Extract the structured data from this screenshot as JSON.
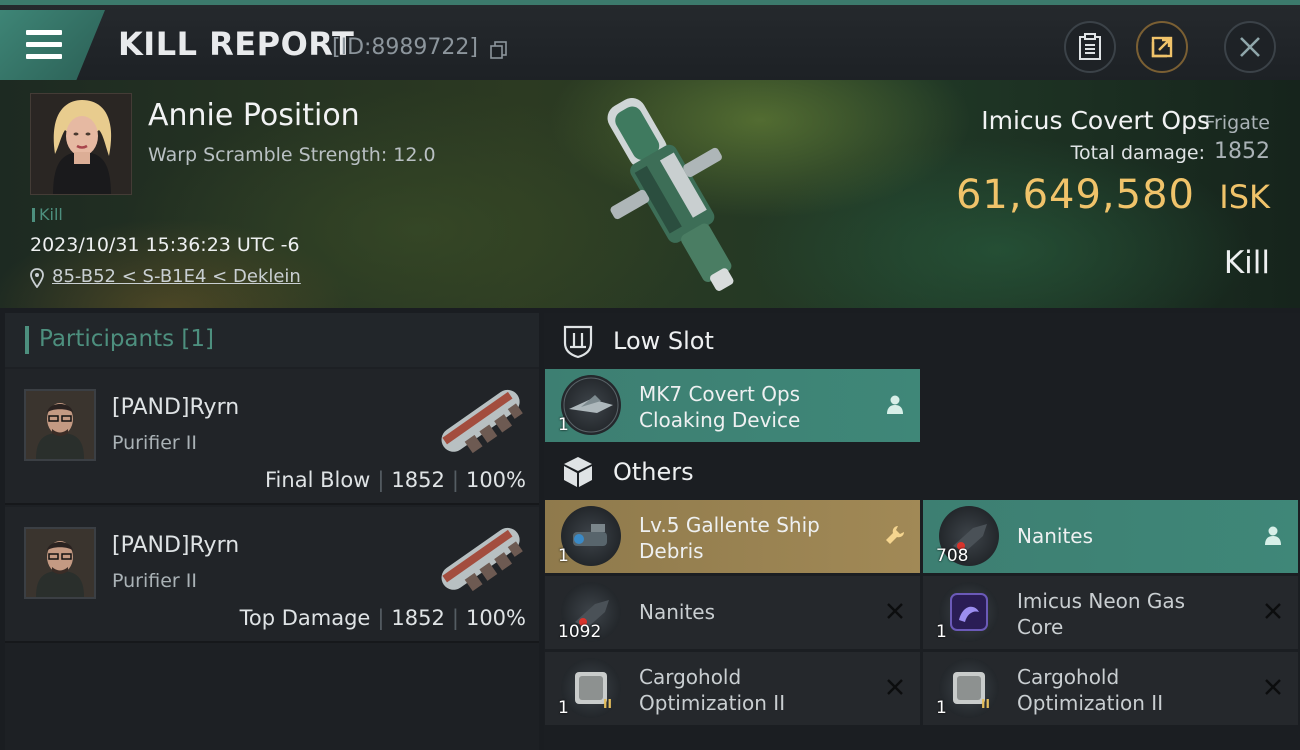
{
  "header": {
    "title": "KILL REPORT",
    "report_id": "[ID:8989722]"
  },
  "victim": {
    "name": "Annie Position",
    "warp_scramble": "Warp Scramble Strength: 12.0",
    "kill_tag": "Kill",
    "datetime": "2023/10/31 15:36:23 UTC -6",
    "location": "85-B52 < S-B1E4 < Deklein",
    "ship_name": "Imicus Covert Ops",
    "ship_class": "Frigate",
    "total_damage_label": "Total damage:",
    "total_damage": "1852",
    "isk_value": "61,649,580",
    "isk_unit": "ISK",
    "result": "Kill"
  },
  "participants": {
    "title": "Participants [1]",
    "rows": [
      {
        "name": "[PAND]Ryrn",
        "ship": "Purifier II",
        "role": "Final Blow",
        "damage": "1852",
        "percent": "100%"
      },
      {
        "name": "[PAND]Ryrn",
        "ship": "Purifier II",
        "role": "Top Damage",
        "damage": "1852",
        "percent": "100%"
      }
    ]
  },
  "sections": {
    "low_slot": "Low Slot",
    "others": "Others"
  },
  "items": {
    "low_slot": [
      {
        "name_line1": "MK7 Covert Ops",
        "name_line2": "Cloaking Device",
        "qty": "1",
        "state": "dropped",
        "icon": "cloak-icon",
        "status_icon": "person-icon"
      }
    ],
    "others": [
      {
        "name_line1": "Lv.5 Gallente Ship",
        "name_line2": "Debris",
        "qty": "1",
        "state": "loot",
        "icon": "debris-icon",
        "status_icon": "wrench-icon"
      },
      {
        "name_line1": "Nanites",
        "name_line2": "",
        "qty": "708",
        "state": "dropped",
        "icon": "nanites-icon",
        "status_icon": "person-icon"
      },
      {
        "name_line1": "Nanites",
        "name_line2": "",
        "qty": "1092",
        "state": "destroyed",
        "icon": "nanites-icon",
        "status_icon": "x-icon"
      },
      {
        "name_line1": "Imicus Neon Gas",
        "name_line2": "Core",
        "qty": "1",
        "state": "destroyed",
        "icon": "neon-core-icon",
        "status_icon": "x-icon"
      },
      {
        "name_line1": "Cargohold",
        "name_line2": "Optimization II",
        "qty": "1",
        "state": "destroyed",
        "icon": "cargohold-icon",
        "status_icon": "x-icon"
      },
      {
        "name_line1": "Cargohold",
        "name_line2": "Optimization II",
        "qty": "1",
        "state": "destroyed",
        "icon": "cargohold-icon",
        "status_icon": "x-icon"
      }
    ]
  },
  "colors": {
    "accent_teal": "#4d8f7e",
    "isk_gold": "#f0c36a",
    "dropped_bg": "#3f8778",
    "loot_bg": "#a18956"
  }
}
